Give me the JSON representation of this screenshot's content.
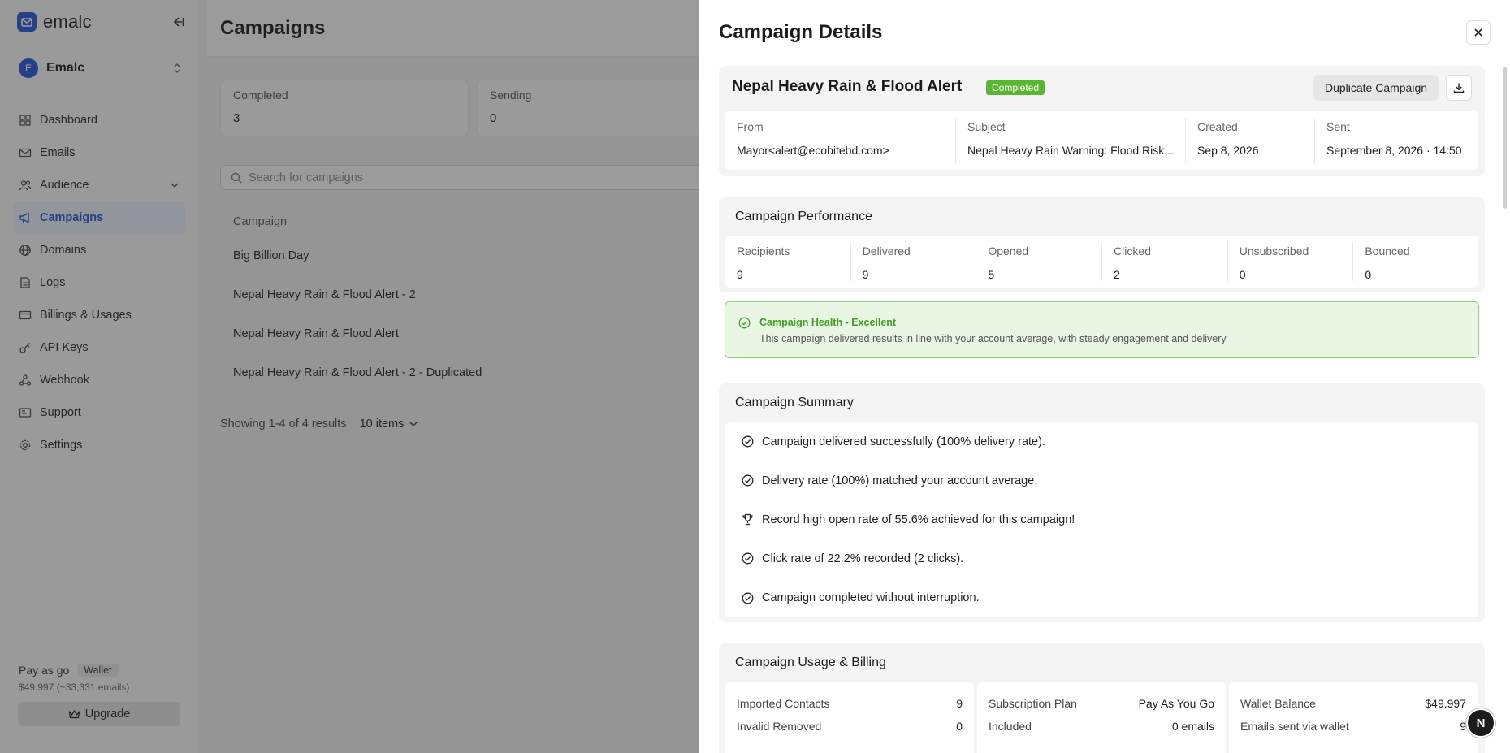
{
  "app": {
    "brand": "emalc",
    "workspace_initial": "E",
    "workspace_name": "Emalc"
  },
  "sidebar": {
    "items": [
      {
        "label": "Dashboard",
        "icon": "dashboard-icon"
      },
      {
        "label": "Emails",
        "icon": "mail-icon"
      },
      {
        "label": "Audience",
        "icon": "users-icon"
      },
      {
        "label": "Campaigns",
        "icon": "megaphone-icon",
        "active": true
      },
      {
        "label": "Domains",
        "icon": "globe-icon"
      },
      {
        "label": "Logs",
        "icon": "log-icon"
      },
      {
        "label": "Billings & Usages",
        "icon": "card-icon"
      },
      {
        "label": "API Keys",
        "icon": "key-icon"
      },
      {
        "label": "Webhook",
        "icon": "webhook-icon"
      },
      {
        "label": "Support",
        "icon": "support-icon"
      },
      {
        "label": "Settings",
        "icon": "gear-icon"
      }
    ],
    "plan_label": "Pay as go",
    "wallet_label": "Wallet",
    "balance_text": "$49.997 (~33,331 emails)",
    "upgrade_label": "Upgrade"
  },
  "main": {
    "title": "Campaigns",
    "stats": [
      {
        "label": "Completed",
        "value": "3"
      },
      {
        "label": "Sending",
        "value": "0"
      }
    ],
    "search_placeholder": "Search for campaigns",
    "table_header": "Campaign",
    "rows": [
      "Big Billion Day",
      "Nepal Heavy Rain & Flood Alert - 2",
      "Nepal Heavy Rain & Flood Alert",
      "Nepal Heavy Rain & Flood Alert - 2 - Duplicated"
    ],
    "pager_text": "Showing 1-4 of 4 results",
    "per_page": "10 items"
  },
  "drawer": {
    "title": "Campaign Details",
    "campaign_name": "Nepal Heavy Rain & Flood Alert",
    "status": "Completed",
    "duplicate_label": "Duplicate Campaign",
    "meta": {
      "from_label": "From",
      "from_value": "Mayor<alert@ecobitebd.com>",
      "subject_label": "Subject",
      "subject_value": "Nepal Heavy Rain Warning: Flood Risk...",
      "created_label": "Created",
      "created_value": "Sep 8, 2026",
      "sent_label": "Sent",
      "sent_value": "September 8, 2026 · 14:50"
    },
    "performance": {
      "title": "Campaign Performance",
      "metrics": [
        {
          "label": "Recipients",
          "value": "9"
        },
        {
          "label": "Delivered",
          "value": "9"
        },
        {
          "label": "Opened",
          "value": "5"
        },
        {
          "label": "Clicked",
          "value": "2"
        },
        {
          "label": "Unsubscribed",
          "value": "0"
        },
        {
          "label": "Bounced",
          "value": "0"
        }
      ]
    },
    "health": {
      "title": "Campaign Health - Excellent",
      "description": "This campaign delivered results in line with your account average, with steady engagement and delivery."
    },
    "summary": {
      "title": "Campaign Summary",
      "items": [
        {
          "text": "Campaign delivered successfully (100% delivery rate).",
          "icon": "check-circle-icon"
        },
        {
          "text": "Delivery rate (100%) matched your account average.",
          "icon": "check-circle-icon"
        },
        {
          "text": "Record high open rate of 55.6% achieved for this campaign!",
          "icon": "trophy-icon"
        },
        {
          "text": "Click rate of 22.2% recorded (2 clicks).",
          "icon": "check-circle-icon"
        },
        {
          "text": "Campaign completed without interruption.",
          "icon": "check-circle-icon"
        }
      ]
    },
    "billing": {
      "title": "Campaign Usage & Billing",
      "cards": [
        {
          "rows": [
            {
              "label": "Imported Contacts",
              "value": "9"
            },
            {
              "label": "Invalid Removed",
              "value": "0"
            }
          ]
        },
        {
          "rows": [
            {
              "label": "Subscription Plan",
              "value": "Pay As You Go"
            },
            {
              "label": "Included",
              "value": "0 emails"
            }
          ]
        },
        {
          "rows": [
            {
              "label": "Wallet Balance",
              "value": "$49.997"
            },
            {
              "label": "Emails sent via wallet",
              "value": "9"
            }
          ]
        }
      ]
    }
  },
  "fab_label": "N",
  "colors": {
    "accent": "#2355d6",
    "success": "#59b630"
  }
}
